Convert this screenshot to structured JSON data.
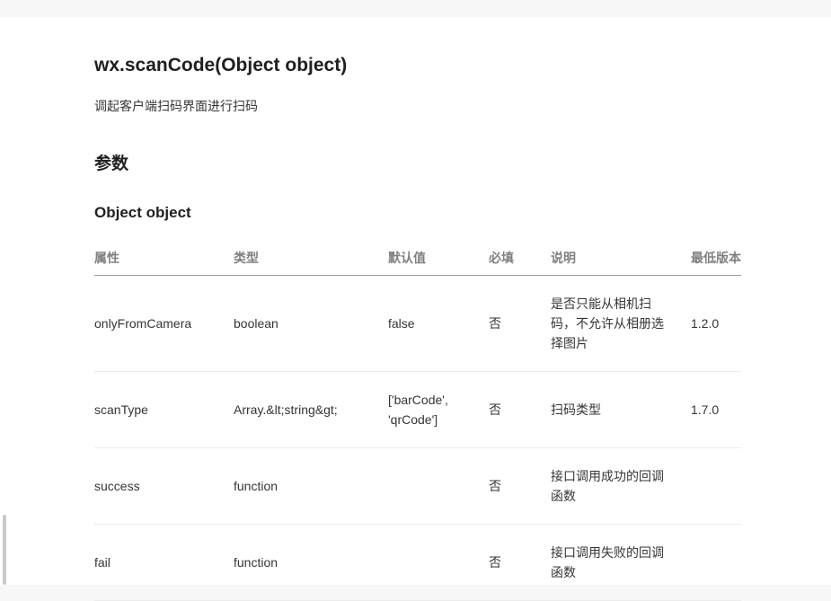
{
  "doc": {
    "title": "wx.scanCode(Object object)",
    "description": "调起客户端扫码界面进行扫码",
    "section_title": "参数",
    "subsection_title": "Object object"
  },
  "table": {
    "headers": [
      "属性",
      "类型",
      "默认值",
      "必填",
      "说明",
      "最低版本"
    ],
    "rows": [
      {
        "property": "onlyFromCamera",
        "type": "boolean",
        "default": "false",
        "required": "否",
        "description": "是否只能从相机扫码，不允许从相册选择图片",
        "min_version": "1.2.0"
      },
      {
        "property": "scanType",
        "type": "Array.&lt;string&gt;",
        "default": "['barCode', 'qrCode']",
        "required": "否",
        "description": "扫码类型",
        "min_version": "1.7.0"
      },
      {
        "property": "success",
        "type": "function",
        "default": "",
        "required": "否",
        "description": "接口调用成功的回调函数",
        "min_version": ""
      },
      {
        "property": "fail",
        "type": "function",
        "default": "",
        "required": "否",
        "description": "接口调用失败的回调函数",
        "min_version": ""
      }
    ]
  }
}
